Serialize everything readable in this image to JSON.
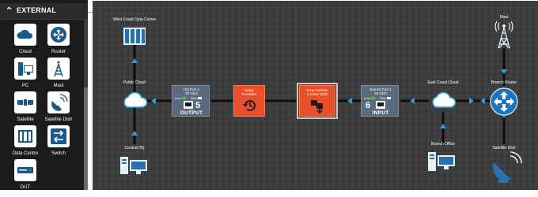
{
  "palette": {
    "section_title": "EXTERNAL",
    "section_icon": "chevron-up-icon",
    "items": [
      {
        "label": "Cloud",
        "icon": "cloud-icon"
      },
      {
        "label": "Router",
        "icon": "router-icon"
      },
      {
        "label": "PC",
        "icon": "pc-icon"
      },
      {
        "label": "Mast",
        "icon": "mast-icon"
      },
      {
        "label": "Satellite",
        "icon": "satellite-icon"
      },
      {
        "label": "Satellite Dish",
        "icon": "satellite-dish-icon"
      },
      {
        "label": "Data Centre",
        "icon": "data-centre-icon"
      },
      {
        "label": "Switch",
        "icon": "switch-icon"
      },
      {
        "label": "DUT",
        "icon": "dut-icon"
      }
    ]
  },
  "canvas": {
    "nodes": {
      "west_dc": {
        "label": "West Coast Data Center",
        "icon": "data-center-icon"
      },
      "public_cloud": {
        "label": "Public Cloud",
        "icon": "cloud-icon"
      },
      "central_hq": {
        "label": "Central HQ",
        "icon": "pc-icon"
      },
      "east_cloud": {
        "label": "East Coast Cloud",
        "icon": "cloud-icon"
      },
      "branch_office": {
        "label": "Branch Office",
        "icon": "pc-icon"
      },
      "mast": {
        "label": "Mast",
        "icon": "mast-icon"
      },
      "branch_router": {
        "label": "Branch Router",
        "icon": "router-icon"
      },
      "satellite_dish": {
        "label": "Satellite Dish",
        "icon": "satellite-dish-icon"
      }
    },
    "output_port": {
      "name": "HQ Port 1",
      "speed": "25 Gb/s",
      "link_label": "Link",
      "pkts_label": "Pkts",
      "number": "5",
      "direction": "OUTPUT"
    },
    "input_port": {
      "name": "Branch Port 1",
      "speed": "25 Gb/s",
      "link_label": "Link",
      "pkts_label": "Pkts",
      "number": "6",
      "direction": "INPUT"
    },
    "delay": {
      "title": "Delay",
      "mode": "Constant",
      "icon": "history-icon"
    },
    "drop": {
      "title": "Drop Packets",
      "detail": "1 every 1000",
      "icon": "drop-packets-icon"
    },
    "colors": {
      "canvas_bg": "#3b3b3b",
      "link_arrow": "#2a9fd8",
      "impairment": "#e94f2b",
      "port": "#5a6c7b",
      "link_led": "#3fd11d"
    }
  }
}
